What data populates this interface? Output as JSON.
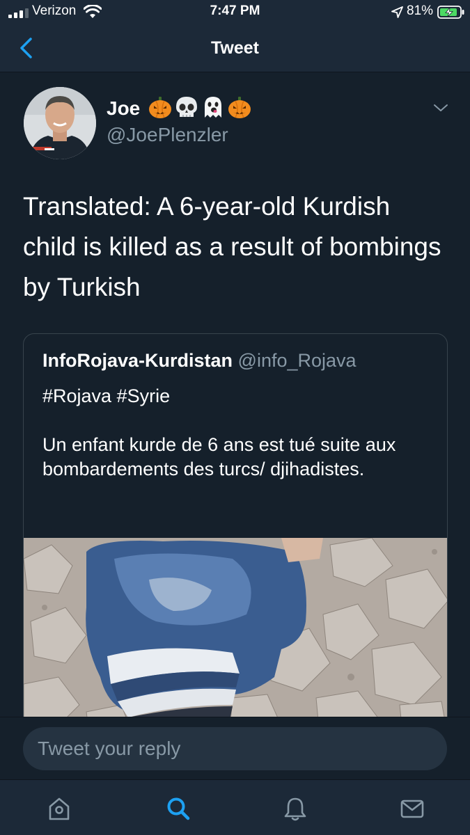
{
  "status_bar": {
    "carrier": "Verizon",
    "time": "7:47 PM",
    "battery_percent": "81%"
  },
  "header": {
    "title": "Tweet"
  },
  "tweet": {
    "author_name": "Joe",
    "author_emoji": [
      "pumpkin",
      "skull",
      "ghost",
      "pumpkin"
    ],
    "author_handle": "@JoePlenzler",
    "text": "Translated: A 6-year-old Kurdish child is killed as a result of bombings by Turkish"
  },
  "quoted_tweet": {
    "author_name": "InfoRojava-Kurdistan",
    "author_handle": "@info_Rojava",
    "text": "#Rojava #Syrie\n\nUn enfant kurde de 6 ans est tué suite aux bombardements des turcs/ djihadistes."
  },
  "reply": {
    "placeholder": "Tweet your reply"
  },
  "tab_bar": {
    "tabs": [
      "home-icon",
      "search-icon",
      "notifications-icon",
      "messages-icon"
    ],
    "active_tab": "search-icon"
  },
  "colors": {
    "background": "#15202b",
    "bar_background": "#1c2938",
    "accent": "#1da1f2",
    "secondary_text": "#8899a6",
    "border": "#38444d"
  }
}
